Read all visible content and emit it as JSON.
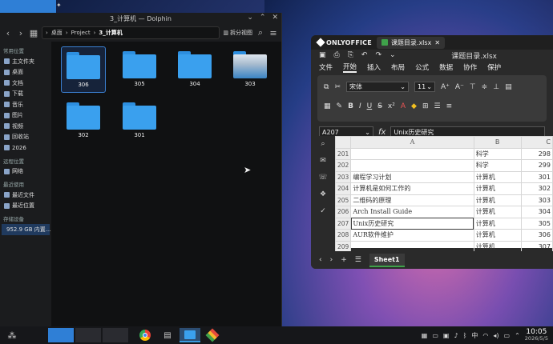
{
  "dolphin": {
    "title": "3_计算机 — Dolphin",
    "breadcrumb": [
      "桌面",
      "Project",
      "3_计算机"
    ],
    "split_label": "拆分视图",
    "sidebar": {
      "places_header": "常用位置",
      "places": [
        "主文件夹",
        "桌面",
        "文档",
        "下载",
        "音乐",
        "图片",
        "视频",
        "回收站",
        "2026"
      ],
      "remote_header": "远程位置",
      "remote": [
        "网络"
      ],
      "recent_header": "最近使用",
      "recent": [
        "最近文件",
        "最近位置"
      ],
      "devices_header": "存储设备",
      "devices": [
        "952.9 GB 内置..."
      ]
    },
    "files": [
      "306",
      "305",
      "304",
      "303",
      "302",
      "301"
    ]
  },
  "onlyoffice": {
    "brand": "ONLYOFFICE",
    "tab_file": "课题目录.xlsx",
    "doc_title": "课题目录.xlsx",
    "menu": [
      "文件",
      "开始",
      "插入",
      "布局",
      "公式",
      "数据",
      "协作",
      "保护"
    ],
    "active_menu": "开始",
    "font_name": "宋体",
    "font_size": "11",
    "cell_ref": "A207",
    "fx": "fx",
    "formula": "Unix历史研究",
    "columns": [
      "A",
      "B",
      "C"
    ],
    "rows": [
      {
        "n": "201",
        "a": "",
        "b": "科学",
        "c": "298"
      },
      {
        "n": "202",
        "a": "",
        "b": "科学",
        "c": "299"
      },
      {
        "n": "203",
        "a": "编程学习计划",
        "b": "计算机",
        "c": "301"
      },
      {
        "n": "204",
        "a": "计算机是如何工作的",
        "b": "计算机",
        "c": "302"
      },
      {
        "n": "205",
        "a": "二维码的原理",
        "b": "计算机",
        "c": "303"
      },
      {
        "n": "206",
        "a": "Arch Install Guide",
        "b": "计算机",
        "c": "304"
      },
      {
        "n": "207",
        "a": "Unix历史研究",
        "b": "计算机",
        "c": "305"
      },
      {
        "n": "208",
        "a": "AUR软件维护",
        "b": "计算机",
        "c": "306"
      },
      {
        "n": "209",
        "a": "",
        "b": "计算机",
        "c": "307"
      }
    ],
    "sheet_tab": "Sheet1"
  },
  "taskbar": {
    "time": "10:05",
    "date": "2026/5/5"
  },
  "colors": {
    "folder": "#3aa0ee",
    "oo_accent": "#3fa14a",
    "selection": "#3a7fd0"
  }
}
